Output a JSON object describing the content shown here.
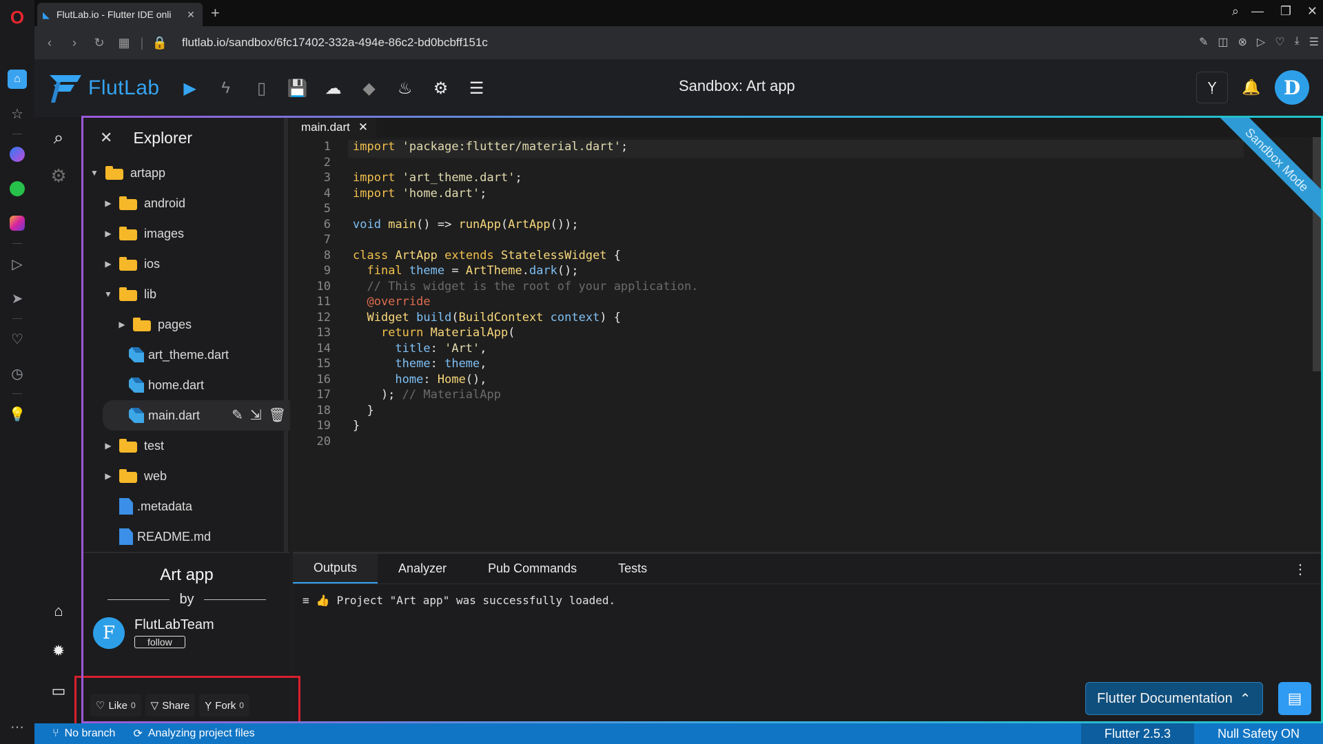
{
  "browser": {
    "tab_title": "FlutLab.io - Flutter IDE onli",
    "url": "flutlab.io/sandbox/6fc17402-332a-494e-86c2-bd0bcbff151c"
  },
  "app": {
    "logo_text": "FlutLab",
    "title": "Sandbox: Art app",
    "avatar_letter": "D",
    "ribbon_text": "Sandbox Mode"
  },
  "explorer": {
    "heading": "Explorer",
    "items": [
      {
        "label": "artapp",
        "type": "folder",
        "level": 0,
        "expanded": true
      },
      {
        "label": "android",
        "type": "folder",
        "level": 1,
        "expanded": false
      },
      {
        "label": "images",
        "type": "folder",
        "level": 1,
        "expanded": false
      },
      {
        "label": "ios",
        "type": "folder",
        "level": 1,
        "expanded": false
      },
      {
        "label": "lib",
        "type": "folder",
        "level": 1,
        "expanded": true
      },
      {
        "label": "pages",
        "type": "folder",
        "level": 2,
        "expanded": false
      },
      {
        "label": "art_theme.dart",
        "type": "dart",
        "level": 2
      },
      {
        "label": "home.dart",
        "type": "dart",
        "level": 2
      },
      {
        "label": "main.dart",
        "type": "dart",
        "level": 2,
        "selected": true
      },
      {
        "label": "test",
        "type": "folder",
        "level": 1,
        "expanded": false
      },
      {
        "label": "web",
        "type": "folder",
        "level": 1,
        "expanded": false
      },
      {
        "label": ".metadata",
        "type": "file",
        "level": 1
      },
      {
        "label": "README.md",
        "type": "file",
        "level": 1
      }
    ]
  },
  "project": {
    "name": "Art app",
    "by": "by",
    "author_initial": "F",
    "author": "FlutLabTeam",
    "follow_label": "follow",
    "like_label": "Like",
    "like_count": "0",
    "share_label": "Share",
    "fork_label": "Fork",
    "fork_count": "0"
  },
  "editor": {
    "tab": "main.dart",
    "lines": [
      "1",
      "2",
      "3",
      "4",
      "5",
      "6",
      "7",
      "8",
      "9",
      "10",
      "11",
      "12",
      "13",
      "14",
      "15",
      "16",
      "17",
      "18",
      "19",
      "20"
    ]
  },
  "output": {
    "tabs": [
      "Outputs",
      "Analyzer",
      "Pub Commands",
      "Tests"
    ],
    "message": "Project \"Art app\" was successfully loaded.",
    "docs_button": "Flutter Documentation"
  },
  "status": {
    "branch": "No branch",
    "analyzing": "Analyzing project files",
    "flutter_version": "Flutter 2.5.3",
    "null_safety": "Null Safety ON"
  },
  "colors": {
    "accent": "#35a4f2",
    "status_bar": "#1175c5",
    "folder": "#f6b829",
    "highlight_box": "#d7202d"
  }
}
